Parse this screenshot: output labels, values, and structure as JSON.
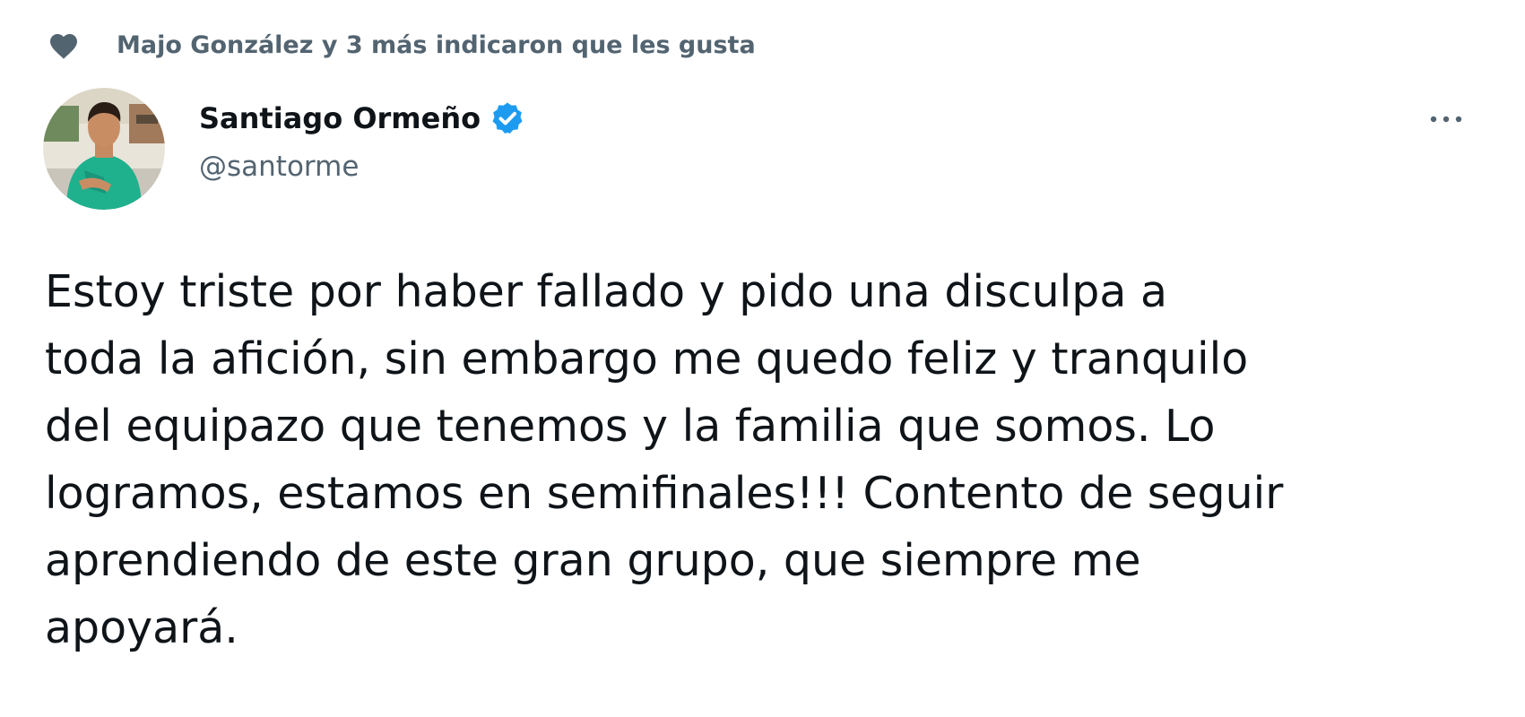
{
  "social_context": {
    "icon": "heart-icon",
    "text": "Majo González y 3 más indicaron que les gusta"
  },
  "author": {
    "display_name": "Santiago Ormeño",
    "handle": "@santorme",
    "verified": true,
    "avatar": "avatar-photo"
  },
  "tweet": {
    "text": "Estoy triste por haber fallado y pido una disculpa a\ntoda la afición, sin embargo me quedo feliz y tranquilo\ndel equipazo que tenemos y la familia que somos. Lo\nlogramos, estamos en semifinales!!! Contento de seguir\naprendiendo de este gran grupo, que siempre me\napoyará."
  },
  "icons": {
    "heart": "heart-icon",
    "verified": "verified-badge-icon",
    "more": "more-options-icon"
  },
  "colors": {
    "secondary_text": "#536471",
    "primary_text": "#0f1419",
    "verified_blue": "#1d9bf0",
    "heart": "#536471"
  }
}
